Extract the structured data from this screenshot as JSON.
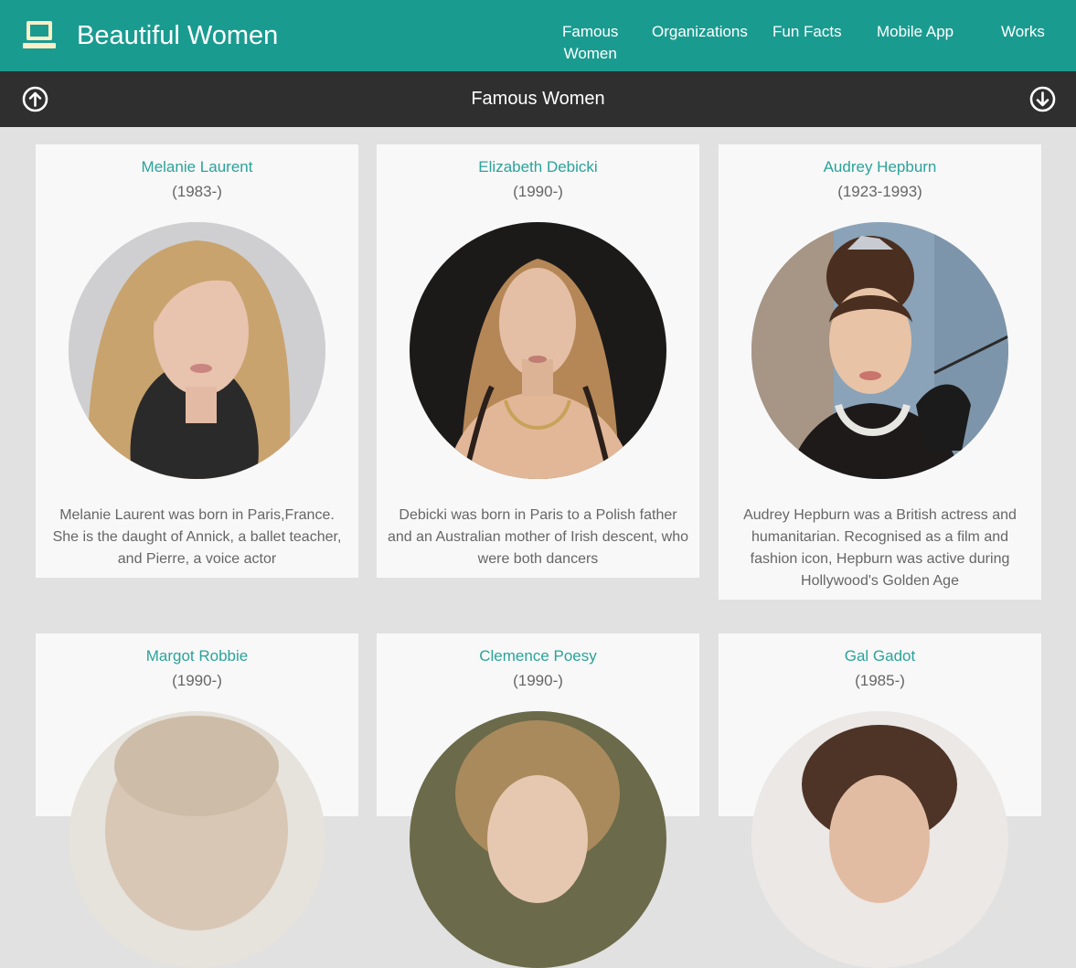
{
  "app": {
    "title": "Beautiful Women",
    "logo_icon": "laptop-icon"
  },
  "nav": [
    {
      "id": "famous",
      "label_line1": "Famous",
      "label_line2": "Women"
    },
    {
      "id": "organizations",
      "label": "Organizations"
    },
    {
      "id": "funfacts",
      "label": "Fun Facts"
    },
    {
      "id": "mobile",
      "label": "Mobile App"
    },
    {
      "id": "works",
      "label": "Works"
    }
  ],
  "section": {
    "title": "Famous Women",
    "up_icon": "arrow-up-circle-icon",
    "down_icon": "arrow-down-circle-icon"
  },
  "cards": [
    {
      "name": "Melanie Laurent",
      "years": "(1983-)",
      "bio": "Melanie Laurent was born in Paris,France. She is the daught of Annick, a ballet teacher, and Pierre, a voice actor"
    },
    {
      "name": "Elizabeth Debicki",
      "years": "(1990-)",
      "bio": "Debicki was born in Paris to a Polish father and an Australian mother of Irish descent, who were both dancers"
    },
    {
      "name": "Audrey Hepburn",
      "years": "(1923-1993)",
      "bio": "Audrey Hepburn was a British actress and humanitarian. Recognised as a film and fashion icon, Hepburn was active during Hollywood's Golden Age"
    },
    {
      "name": "Margot Robbie",
      "years": "(1990-)",
      "bio": ""
    },
    {
      "name": "Clemence Poesy",
      "years": "(1990-)",
      "bio": ""
    },
    {
      "name": "Gal Gadot",
      "years": "(1985-)",
      "bio": ""
    }
  ],
  "colors": {
    "header": "#1a9b90",
    "subbar": "#2f2f2f",
    "accent": "#2aa39a",
    "background": "#e1e1e1",
    "card": "#f8f8f8"
  }
}
